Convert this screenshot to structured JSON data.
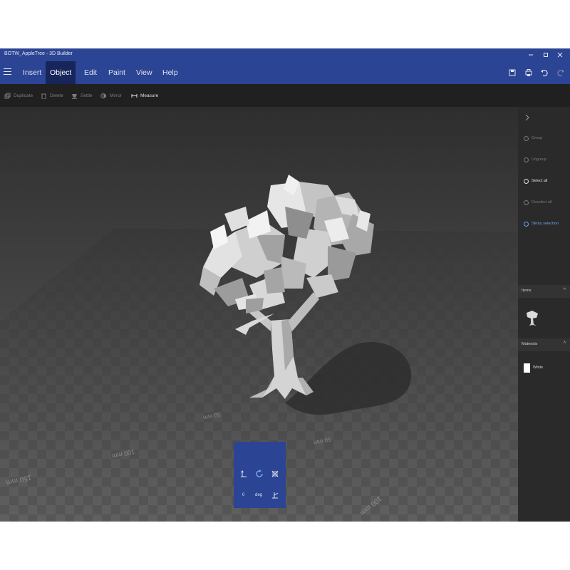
{
  "window": {
    "title": "BOTW_AppleTree - 3D Builder",
    "controls": [
      "minimize",
      "maximize",
      "close"
    ]
  },
  "menu": {
    "tabs": [
      {
        "label": "Insert",
        "active": false
      },
      {
        "label": "Object",
        "active": true
      },
      {
        "label": "Edit",
        "active": false
      },
      {
        "label": "Paint",
        "active": false
      },
      {
        "label": "View",
        "active": false
      },
      {
        "label": "Help",
        "active": false
      }
    ]
  },
  "commands": {
    "duplicate": "Duplicate",
    "delete": "Delete",
    "settle": "Settle",
    "mirror": "Mirror",
    "measure": "Measure"
  },
  "viewport": {
    "grid_labels": [
      "100 mm",
      "50 mm",
      "50 mm",
      "150 mm",
      "100 mm"
    ]
  },
  "panel": {
    "group": "Group",
    "ungroup": "Ungroup",
    "select_all": "Select all",
    "deselect_all": "Deselect all",
    "sticky_selection": "Sticky selection",
    "items_header": "Items",
    "materials_header": "Materials",
    "material_name": "White",
    "material_color": "#ffffff"
  },
  "rotate_tool": {
    "value": "0",
    "unit": "deg"
  },
  "colors": {
    "accent": "#2b4494",
    "active_tab": "#18255a",
    "highlight": "#6fa3e6"
  }
}
